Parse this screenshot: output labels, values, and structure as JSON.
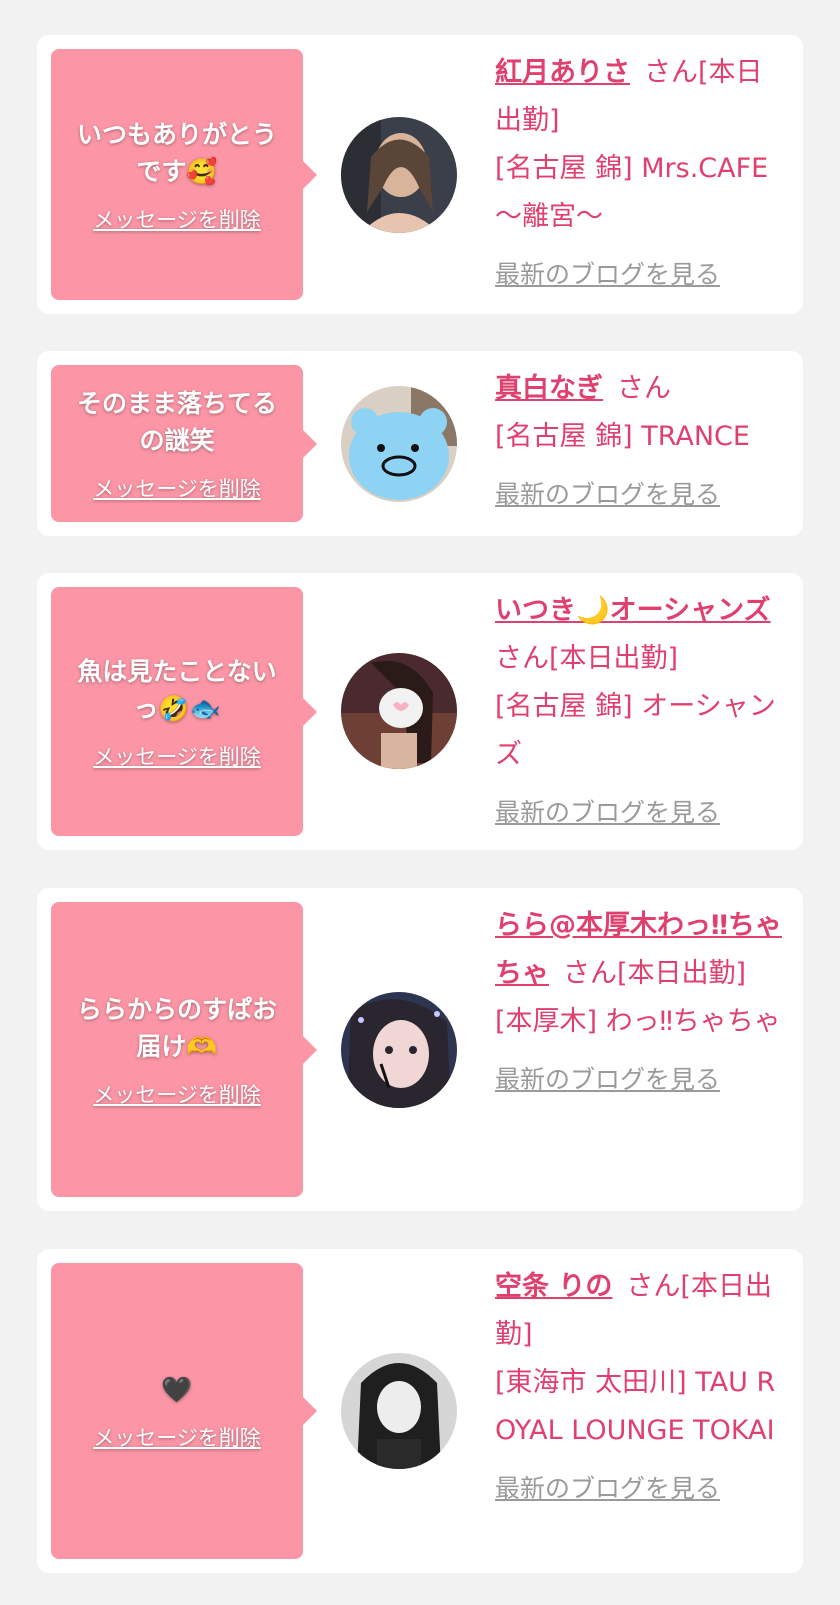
{
  "colors": {
    "background": "#f2f2f2",
    "card": "#ffffff",
    "bubble": "#fc96a6",
    "accent": "#e0406e",
    "link_gray": "#9a9a9a"
  },
  "messages": [
    {
      "text": "いつもありがとうです🥰",
      "delete_label": "メッセージを削除",
      "name": "紅月ありさ",
      "suffix": "さん[本日出勤]",
      "shop": "[名古屋 錦] Mrs.CAFE 〜離宮〜",
      "blog_label": "最新のブログを見る"
    },
    {
      "text": "そのまま落ちてるの謎笑",
      "delete_label": "メッセージを削除",
      "name": "真白なぎ",
      "suffix": "さん",
      "shop": "[名古屋 錦] TRANCE",
      "blog_label": "最新のブログを見る"
    },
    {
      "text": "魚は見たことないっ🤣🐟",
      "delete_label": "メッセージを削除",
      "name": "いつき🌙オーシャンズ",
      "suffix": "さん[本日出勤]",
      "shop": "[名古屋 錦] オーシャンズ",
      "blog_label": "最新のブログを見る"
    },
    {
      "text": "ららからのすぱお届け🫶",
      "delete_label": "メッセージを削除",
      "name": "らら@本厚木わっ‼ちゃちゃ",
      "suffix": "さん[本日出勤]",
      "shop": "[本厚木] わっ‼ちゃちゃ",
      "blog_label": "最新のブログを見る"
    },
    {
      "text": "🖤",
      "delete_label": "メッセージを削除",
      "name": "空条 りの",
      "suffix": "さん[本日出勤]",
      "shop": "[東海市 太田川] TAU ROYAL LOUNGE TOKAI",
      "blog_label": "最新のブログを見る"
    }
  ]
}
